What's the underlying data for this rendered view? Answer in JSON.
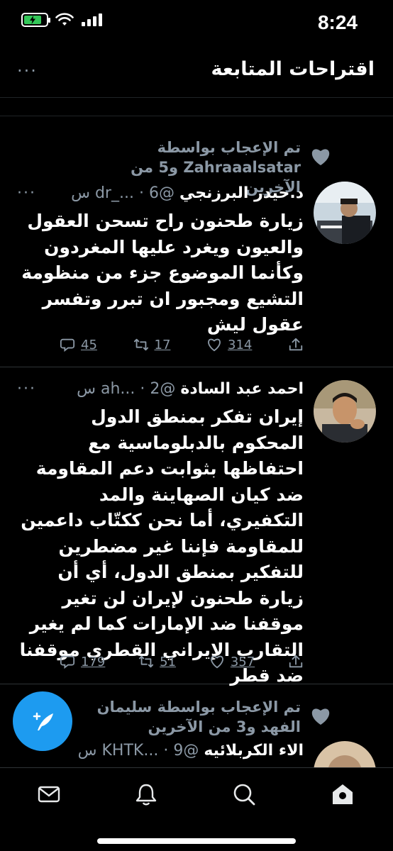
{
  "status_bar": {
    "time": "8:24",
    "battery_color": "#34c759"
  },
  "header": {
    "title": "اقتراحات المتابعة",
    "more_icon": "more-horizontal-icon"
  },
  "tweets": [
    {
      "social_context": "تم الإعجاب بواسطة Zahraaalsatar و5 من الآخرين",
      "name": "د.حيدر البرزنجي",
      "handle": "@dr_...",
      "dot": "·",
      "time": "6 س",
      "text": "زيارة طحنون راح تسحن العقول والعيون ويغرد عليها المغردون وكأنما الموضوع جزء من منظومة التشيع ومجبور ان تبرر وتفسر عقول ليش",
      "replies": "45",
      "retweets": "17",
      "likes": "314"
    },
    {
      "name": "احمد عبد السادة",
      "handle": "@ah...",
      "dot": "·",
      "time": "2 س",
      "text": "إيران تفكر بمنطق الدول المحكوم بالدبلوماسية مع احتفاظها بثوابت دعم المقاومة ضد كيان الصهاينة والمد التكفيري، أما نحن ككتّاب داعمين للمقاومة فإننا غير مضطرين للتفكير بمنطق الدول، أي أن زيارة طحنون لإيران لن تغير موقفنا ضد الإمارات كما لم يغير التقارب الإيراني القطري موقفنا ضد قطر",
      "replies": "179",
      "retweets": "51",
      "likes": "357"
    },
    {
      "social_context": "تم الإعجاب بواسطة سليمان الفهد و3 من الآخرين",
      "name": "الاء الكربلائيه",
      "handle": "@KHTK...",
      "dot": "·",
      "time": "9 س"
    }
  ],
  "colors": {
    "accent": "#1d9bf0",
    "muted": "#8b98a5",
    "background": "#000000"
  },
  "nav": [
    "mail-icon",
    "bell-icon",
    "search-icon",
    "home-icon"
  ]
}
